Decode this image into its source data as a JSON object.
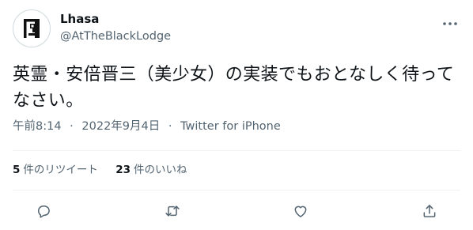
{
  "user": {
    "display_name": "Lhasa",
    "handle": "@AtTheBlackLodge"
  },
  "tweet": {
    "text": "英霊・安倍晋三（美少女）の実装でもおとなしく待ってなさい。",
    "time": "午前8:14",
    "date": "2022年9月4日",
    "source": "Twitter for iPhone",
    "separator": "·"
  },
  "stats": {
    "retweets": {
      "count": "5",
      "label": "件のリツイート"
    },
    "likes": {
      "count": "23",
      "label": "件のいいね"
    }
  },
  "icons": {
    "more": "more-horizontal-icon",
    "reply": "reply-icon",
    "retweet": "retweet-icon",
    "like": "heart-icon",
    "share": "share-icon"
  },
  "colors": {
    "text": "#0f1419",
    "secondary": "#536471",
    "divider": "#eff3f4"
  }
}
